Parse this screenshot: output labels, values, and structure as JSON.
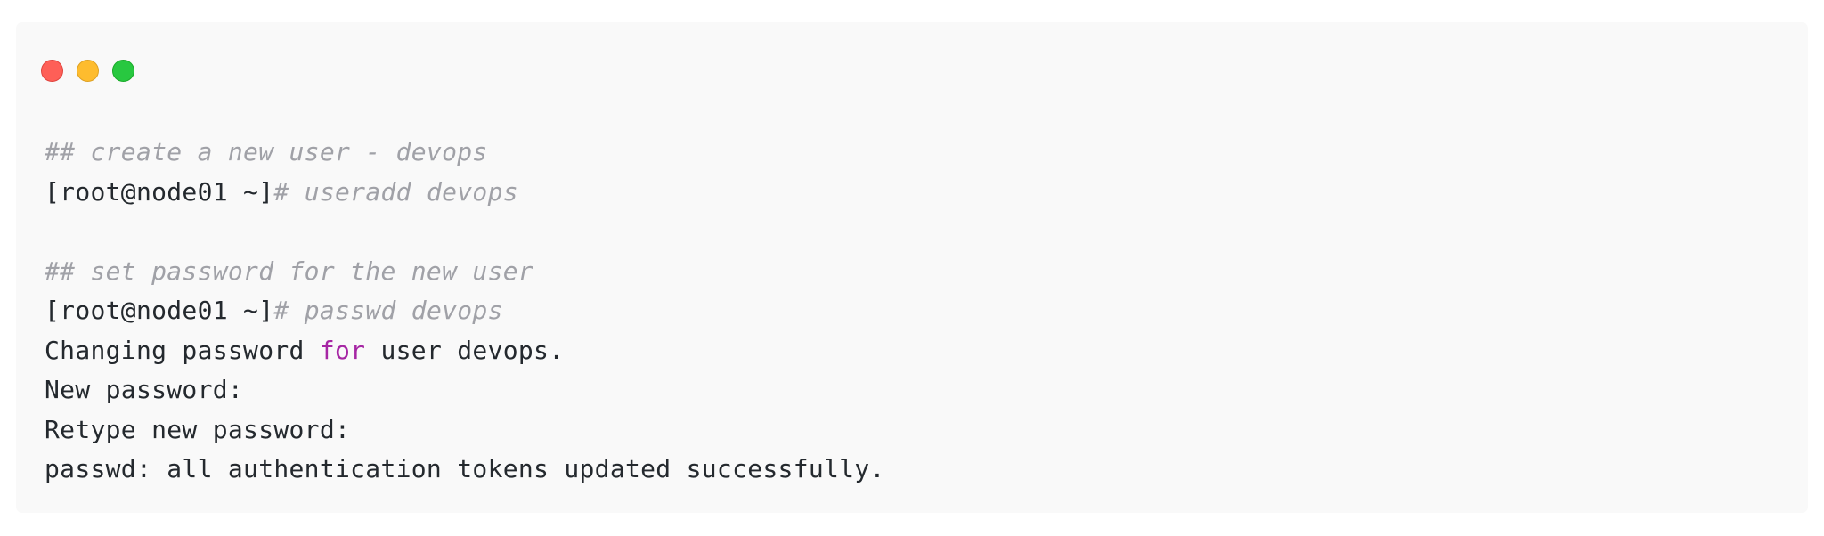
{
  "window": {
    "controls": [
      {
        "name": "close",
        "color": "#fe5f57"
      },
      {
        "name": "minimize",
        "color": "#febc2e"
      },
      {
        "name": "zoom",
        "color": "#28c840"
      }
    ]
  },
  "code": {
    "line1_comment": "## create a new user - devops",
    "line2_prompt": "[root@node01 ~]",
    "line2_command": "# useradd devops",
    "line4_comment": "## set password for the new user",
    "line5_prompt": "[root@node01 ~]",
    "line5_command": "# passwd devops",
    "line6_pre": "Changing password ",
    "line6_keyword": "for",
    "line6_post": " user devops.",
    "line7": "New password:",
    "line8": "Retype new password:",
    "line9": "passwd: all authentication tokens updated successfully."
  },
  "colors": {
    "background": "#f9f9f9",
    "text": "#24292e",
    "comment": "#a0a1a7",
    "keyword": "#a626a4"
  }
}
